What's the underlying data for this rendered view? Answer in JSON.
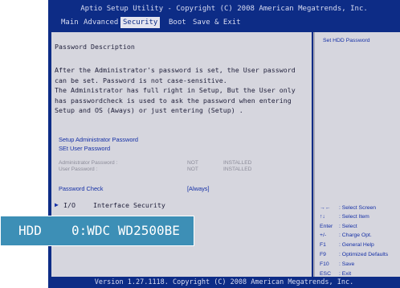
{
  "title": "Aptio Setup Utility - Copyright (C) 2008 American Megatrends, Inc.",
  "tabs": [
    "Main",
    "Advanced",
    "Security",
    "Boot",
    "Save & Exit"
  ],
  "active_tab": "Security",
  "panel": {
    "heading": "Password Description",
    "description": "After the Administrator's password is set, the User password\ncan be set. Password is not case-sensitive.\nThe Administrator has full right in Setup, But the User only\nhas passwordcheck is used to ask the password when entering\nSetup and OS (Aways) or just entering (Setup) .",
    "setup_admin_password": "Setup Administrator Password",
    "set_user_password": "SEt User Password",
    "admin_password_label": "Administrator Password :",
    "admin_password_status": "NOT",
    "admin_password_installed": "INSTALLED",
    "user_password_label": "User Password :",
    "user_password_status": "NOT",
    "user_password_installed": "INSTALLED",
    "password_check_label": "Password Check",
    "password_check_value": "[Always]",
    "io_arrow": "▶",
    "io_label": "I/O",
    "io_value": "Interface Security"
  },
  "help": {
    "title": "Set HDD Password",
    "keys": [
      {
        "key": "→←",
        "desc": ": Select Screen"
      },
      {
        "key": "↑↓",
        "desc": ": Select Item"
      },
      {
        "key": "Enter",
        "desc": ": Select"
      },
      {
        "key": "+/-",
        "desc": ": Charge Opt."
      },
      {
        "key": "F1",
        "desc": ": General Help"
      },
      {
        "key": "F9",
        "desc": ": Optimized Defaults"
      },
      {
        "key": "F10",
        "desc": ": Save"
      },
      {
        "key": "ESC",
        "desc": ": Exit"
      }
    ]
  },
  "footer": "Version 1.27.1118. Copyright (C) 2008 American Megatrends, Inc.",
  "overlay": {
    "label": "HDD",
    "value": "0:WDC WD2500BE"
  },
  "colors": {
    "bios_blue": "#0d2c86",
    "panel_gray": "#d6d6de",
    "accent_text": "#1530a6",
    "overlay_bg": "#3d8fb6"
  }
}
